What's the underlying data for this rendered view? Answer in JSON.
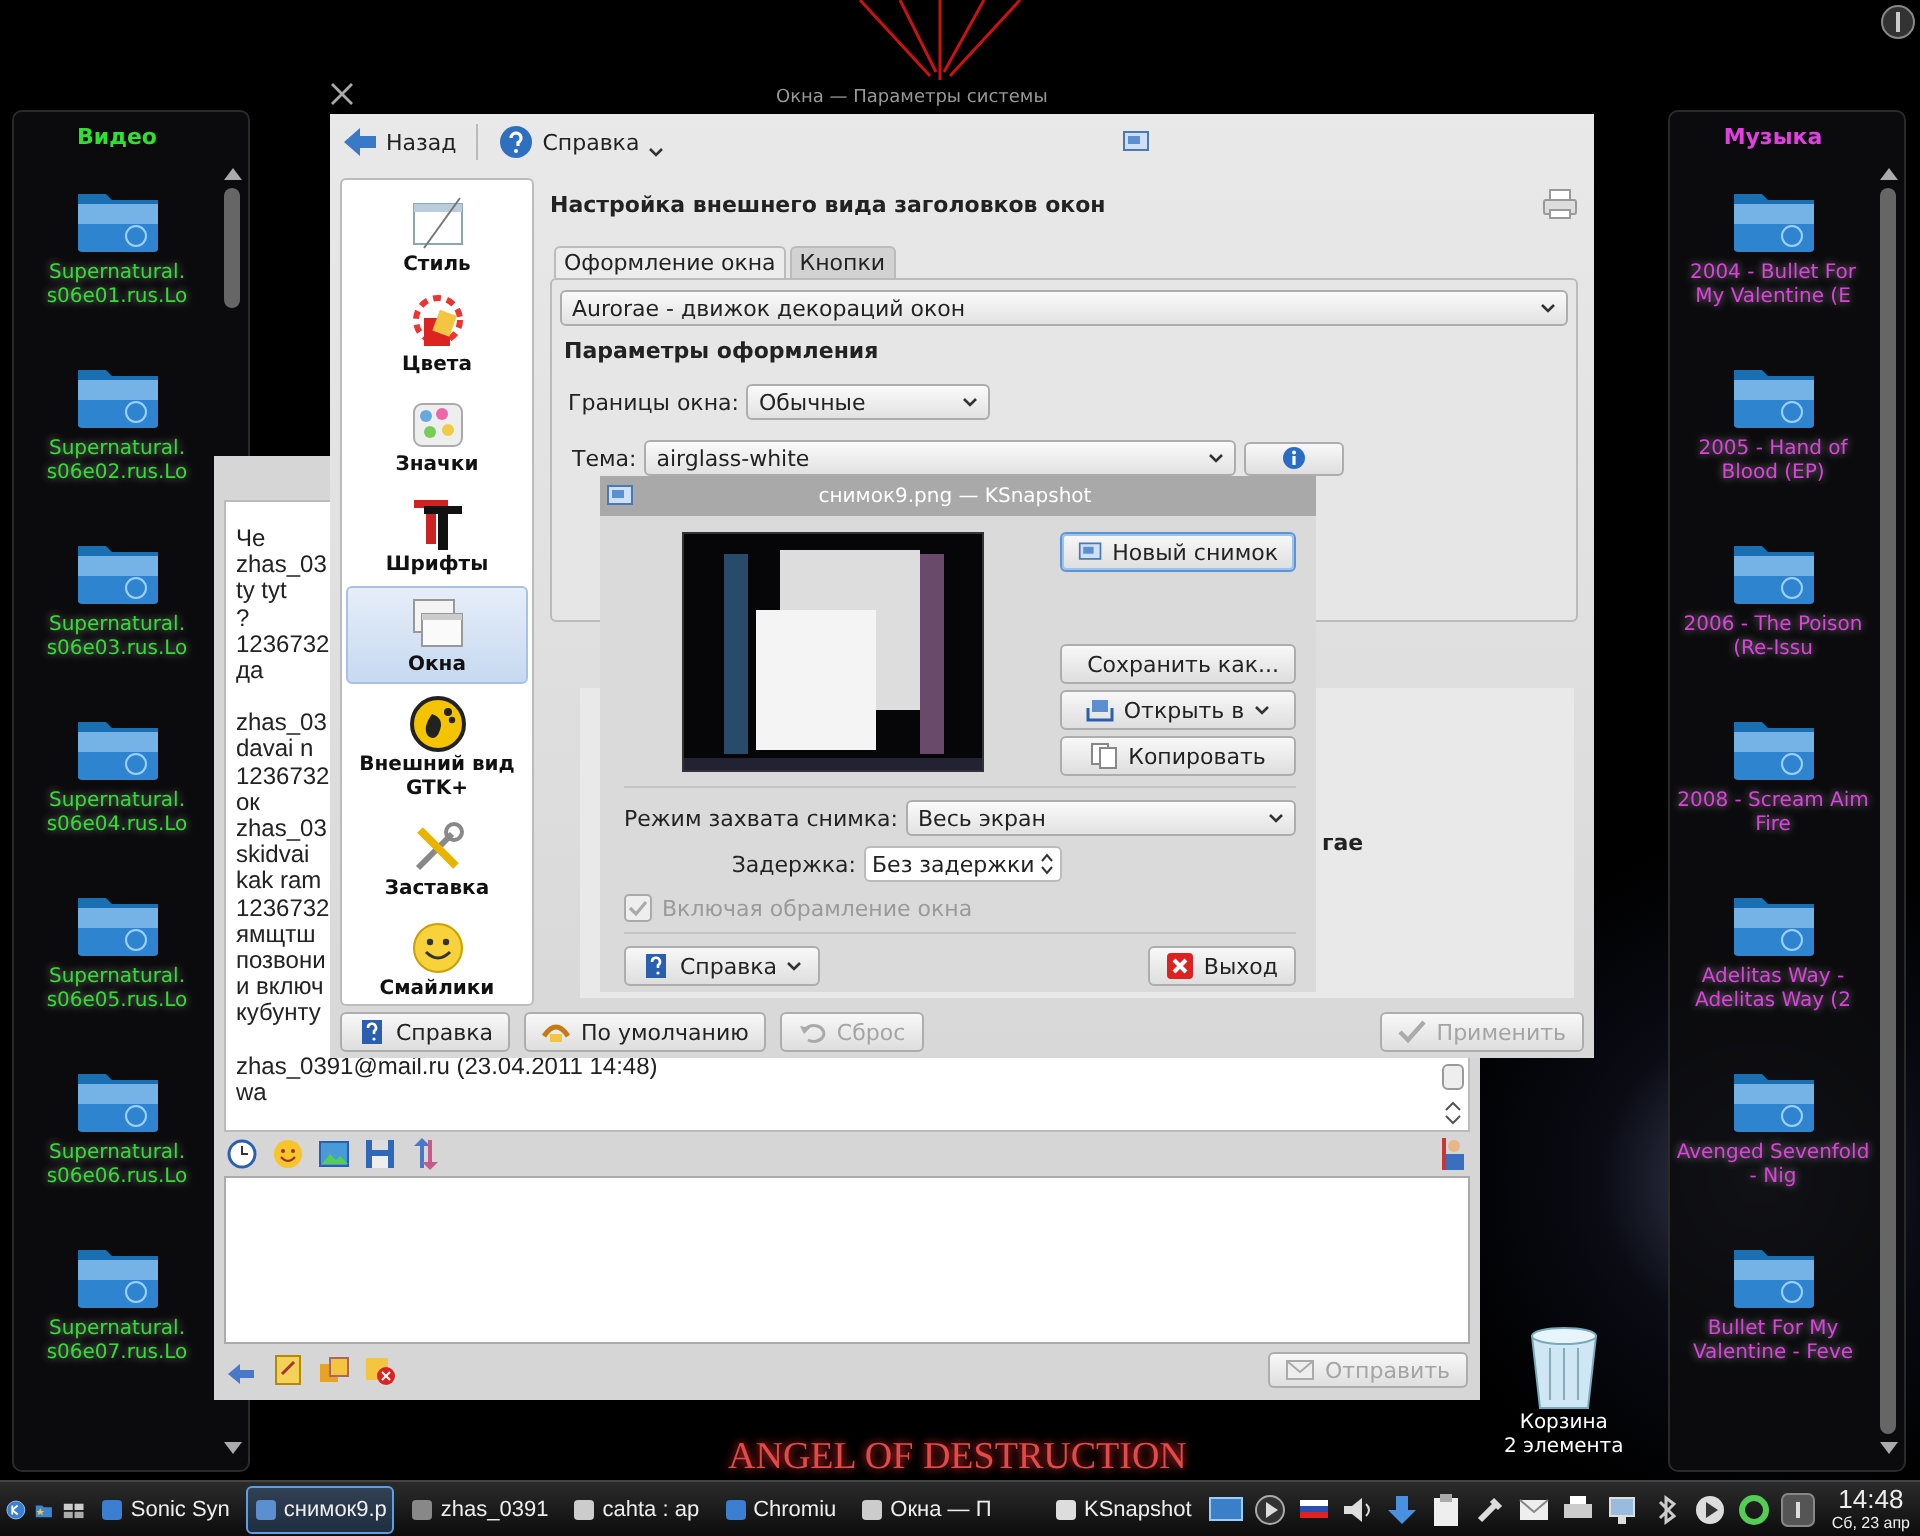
{
  "desktop": {
    "top_title": "Окна — Параметры системы",
    "wallpaper_text": "ANGEL OF DESTRUCTION"
  },
  "video_folder": {
    "title": "Видео",
    "items": [
      {
        "label": "Supernatural. s06e01.rus.Lo"
      },
      {
        "label": "Supernatural. s06e02.rus.Lo"
      },
      {
        "label": "Supernatural. s06e03.rus.Lo"
      },
      {
        "label": "Supernatural. s06e04.rus.Lo"
      },
      {
        "label": "Supernatural. s06e05.rus.Lo"
      },
      {
        "label": "Supernatural. s06e06.rus.Lo"
      },
      {
        "label": "Supernatural. s06e07.rus.Lo"
      }
    ]
  },
  "music_folder": {
    "title": "Музыка",
    "items": [
      {
        "label": "2004 - Bullet For My Valentine (E"
      },
      {
        "label": "2005 - Hand of Blood (EP)"
      },
      {
        "label": "2006 - The Poison (Re-Issu"
      },
      {
        "label": "2008 - Scream Aim Fire"
      },
      {
        "label": "Adelitas Way - Adelitas Way (2"
      },
      {
        "label": "Avenged Sevenfold - Nig"
      },
      {
        "label": "Bullet For My Valentine - Feve"
      }
    ]
  },
  "trash": {
    "label": "Корзина",
    "count": "2 элемента"
  },
  "chat_window": {
    "message_groups": [
      {
        "lines": [
          "Че",
          "zhas_03",
          "ty tyt",
          "?",
          "1236732",
          "да"
        ]
      },
      {
        "lines": [
          "zhas_03",
          "davai n",
          "1236732",
          "ок",
          "zhas_03",
          "skidvai",
          "kak ram",
          "1236732",
          "ямщтш",
          "позвони",
          "и включ",
          "кубунту"
        ]
      },
      {
        "lines": [
          "zhas_0391@mail.ru (23.04.2011 14:48)",
          "wa"
        ]
      }
    ],
    "send_button": {
      "label": "Отправить",
      "disabled": true
    }
  },
  "settings_window": {
    "toolbar": [
      {
        "label": "Назад",
        "kind": "back"
      },
      {
        "label": "Справка",
        "kind": "help"
      }
    ],
    "sidebar": [
      {
        "label": "Стиль",
        "selected": false
      },
      {
        "label": "Цвета",
        "selected": false
      },
      {
        "label": "Значки",
        "selected": false
      },
      {
        "label": "Шрифты",
        "selected": false
      },
      {
        "label": "Окна",
        "selected": true
      },
      {
        "label": "Внешний вид GTK+",
        "selected": false
      },
      {
        "label": "Заставка",
        "selected": false
      },
      {
        "label": "Смайлики",
        "selected": false
      }
    ],
    "heading": "Настройка внешнего вида заголовков окон",
    "tabs": [
      {
        "label": "Оформление окна",
        "selected": true
      },
      {
        "label": "Кнопки",
        "selected": false
      }
    ],
    "decoration_engine": "Aurorae - движок декораций окон",
    "section_title": "Параметры оформления",
    "border_label": "Границы окна:",
    "border_value": "Обычные",
    "theme_label": "Тема:",
    "theme_value": "airglass-white",
    "preview_text": "гае",
    "buttons": [
      {
        "label": "Справка",
        "disabled": false
      },
      {
        "label": "По умолчанию",
        "disabled": false
      },
      {
        "label": "Сброс",
        "disabled": true
      },
      {
        "label": "Применить",
        "disabled": true
      }
    ]
  },
  "ksnapshot": {
    "title": "снимок9.png — KSnapshot",
    "actions": [
      {
        "label": "Новый снимок",
        "kind": "button",
        "focused": true
      },
      {
        "label": "Сохранить как...",
        "kind": "button",
        "focused": false
      },
      {
        "label": "Открыть в",
        "kind": "menu",
        "focused": false
      },
      {
        "label": "Копировать",
        "kind": "button",
        "focused": false
      }
    ],
    "mode_label": "Режим захвата снимка:",
    "mode_value": "Весь экран",
    "delay_label": "Задержка:",
    "delay_value": "Без задержки",
    "include_decorations": {
      "label": "Включая обрамление окна",
      "checked": true,
      "disabled": true
    },
    "bottom_buttons": [
      {
        "label": "Справка",
        "kind": "menu"
      },
      {
        "label": "Выход",
        "kind": "quit"
      }
    ]
  },
  "taskbar": {
    "tasks": [
      {
        "label": "Sonic Syn",
        "selected": false
      },
      {
        "label": "снимок9.p",
        "selected": true
      },
      {
        "label": "zhas_0391",
        "selected": false
      },
      {
        "label": "cahta : ap",
        "selected": false
      },
      {
        "label": "Chromiu",
        "selected": false
      },
      {
        "label": "Окна — П",
        "selected": false
      },
      {
        "label": "KSnapshot",
        "selected": false
      }
    ],
    "time": "14:48",
    "date": "Сб, 23 апр"
  }
}
